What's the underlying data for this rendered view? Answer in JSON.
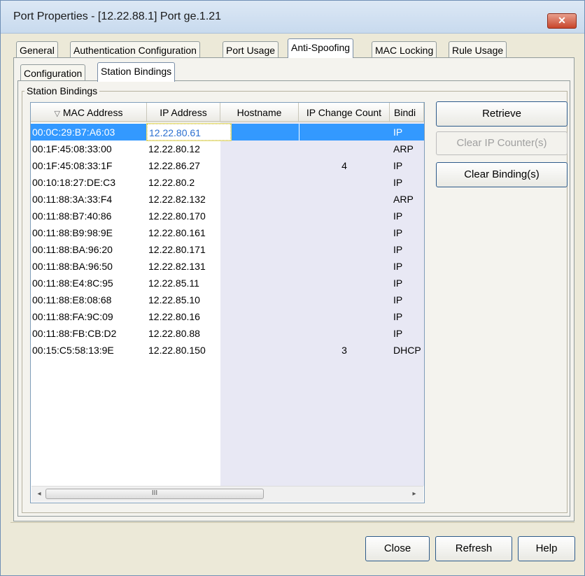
{
  "window": {
    "title": "Port Properties - [12.22.88.1] Port ge.1.21",
    "close_glyph": "✕"
  },
  "main_tabs": [
    {
      "label": "General"
    },
    {
      "label": "Authentication Configuration"
    },
    {
      "label": "Port Usage"
    },
    {
      "label": "Anti-Spoofing",
      "active": true
    },
    {
      "label": "MAC Locking"
    },
    {
      "label": "Rule Usage"
    }
  ],
  "sub_tabs": [
    {
      "label": "Configuration"
    },
    {
      "label": "Station Bindings",
      "active": true
    }
  ],
  "group": {
    "label": "Station Bindings"
  },
  "table": {
    "columns": [
      "MAC Address",
      "IP Address",
      "Hostname",
      "IP Change Count",
      "Bindi"
    ],
    "sort_glyph": "▽",
    "rows": [
      {
        "mac": "00:0C:29:B7:A6:03",
        "ip": "12.22.80.61",
        "hostname": "",
        "changes": "",
        "binding": "IP",
        "selected": true
      },
      {
        "mac": "00:1F:45:08:33:00",
        "ip": "12.22.80.12",
        "hostname": "",
        "changes": "",
        "binding": "ARP"
      },
      {
        "mac": "00:1F:45:08:33:1F",
        "ip": "12.22.86.27",
        "hostname": "",
        "changes": "4",
        "binding": "IP"
      },
      {
        "mac": "00:10:18:27:DE:C3",
        "ip": "12.22.80.2",
        "hostname": "",
        "changes": "",
        "binding": "IP"
      },
      {
        "mac": "00:11:88:3A:33:F4",
        "ip": "12.22.82.132",
        "hostname": "",
        "changes": "",
        "binding": "ARP"
      },
      {
        "mac": "00:11:88:B7:40:86",
        "ip": "12.22.80.170",
        "hostname": "",
        "changes": "",
        "binding": "IP"
      },
      {
        "mac": "00:11:88:B9:98:9E",
        "ip": "12.22.80.161",
        "hostname": "",
        "changes": "",
        "binding": "IP"
      },
      {
        "mac": "00:11:88:BA:96:20",
        "ip": "12.22.80.171",
        "hostname": "",
        "changes": "",
        "binding": "IP"
      },
      {
        "mac": "00:11:88:BA:96:50",
        "ip": "12.22.82.131",
        "hostname": "",
        "changes": "",
        "binding": "IP"
      },
      {
        "mac": "00:11:88:E4:8C:95",
        "ip": "12.22.85.11",
        "hostname": "",
        "changes": "",
        "binding": "IP"
      },
      {
        "mac": "00:11:88:E8:08:68",
        "ip": "12.22.85.10",
        "hostname": "",
        "changes": "",
        "binding": "IP"
      },
      {
        "mac": "00:11:88:FA:9C:09",
        "ip": "12.22.80.16",
        "hostname": "",
        "changes": "",
        "binding": "IP"
      },
      {
        "mac": "00:11:88:FB:CB:D2",
        "ip": "12.22.80.88",
        "hostname": "",
        "changes": "",
        "binding": "IP"
      },
      {
        "mac": "00:15:C5:58:13:9E",
        "ip": "12.22.80.150",
        "hostname": "",
        "changes": "3",
        "binding": "DHCP"
      }
    ]
  },
  "scrollbar": {
    "left_arrow": "◂",
    "right_arrow": "▸",
    "grip": "III"
  },
  "side_buttons": {
    "retrieve": "Retrieve",
    "clear_ip_counters": "Clear IP Counter(s)",
    "clear_bindings": "Clear Binding(s)"
  },
  "footer_buttons": {
    "close": "Close",
    "refresh": "Refresh",
    "help": "Help"
  },
  "colors": {
    "selection": "#3399ff",
    "window_bg": "#ece9d8",
    "close_button": "#c8452b"
  }
}
